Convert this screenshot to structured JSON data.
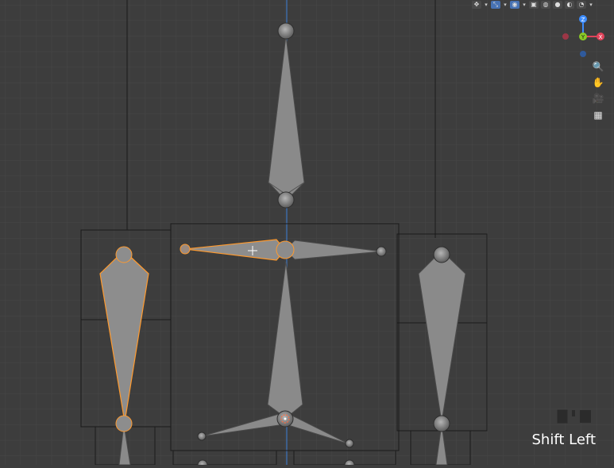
{
  "viewport": {
    "background": "#3d3d3d",
    "grid_color": "#474747",
    "axis_color": "#3d7fd6",
    "bone_fill": "#8a8a8a",
    "selected_outline": "#ff9a2e"
  },
  "header": {
    "icons": [
      {
        "name": "cursor-tool-icon",
        "glyph": "✥"
      },
      {
        "name": "transform-gizmo-icon",
        "glyph": "⤡"
      },
      {
        "name": "overlays-icon",
        "glyph": "◉"
      },
      {
        "name": "xray-icon",
        "glyph": "▣"
      },
      {
        "name": "wireframe-shading-icon",
        "glyph": "◍"
      },
      {
        "name": "solid-shading-icon",
        "glyph": "●"
      },
      {
        "name": "material-shading-icon",
        "glyph": "◐"
      },
      {
        "name": "rendered-shading-icon",
        "glyph": "◔"
      }
    ]
  },
  "gizmo": {
    "x_label": "X",
    "y_label": "Y",
    "z_label": "Z",
    "x_color": "#e0435a",
    "y_color": "#8ac926",
    "z_color": "#3c8cff"
  },
  "navigation": {
    "zoom_icon": "🔍",
    "pan_icon": "✋",
    "camera_icon": "🎥",
    "ortho_icon": "▦"
  },
  "key_overlay": {
    "text": "Shift Left"
  }
}
